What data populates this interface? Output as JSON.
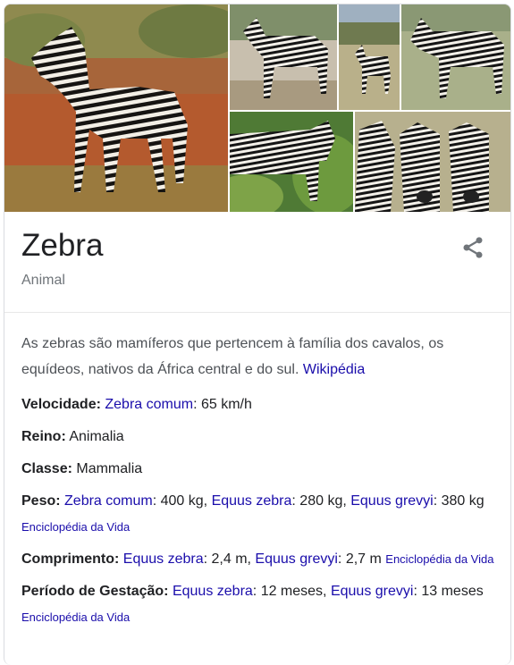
{
  "entity": {
    "title": "Zebra",
    "subtitle": "Animal"
  },
  "description": {
    "text": "As zebras são mamíferos que pertencem à família dos cavalos, os equídeos, nativos da África central e do sul.",
    "source": "Wikipédia"
  },
  "icons": {
    "share": "share-icon"
  },
  "facts": {
    "velocidade": {
      "label": "Velocidade:",
      "link1": "Zebra comum",
      "value1": ": 65 km/h"
    },
    "reino": {
      "label": "Reino:",
      "value": " Animalia"
    },
    "classe": {
      "label": "Classe:",
      "value": " Mammalia"
    },
    "peso": {
      "label": "Peso:",
      "link1": "Zebra comum",
      "value1": ": 400 kg, ",
      "link2": "Equus zebra",
      "value2": ": 280 kg, ",
      "link3": "Equus grevyi",
      "value3": ": 380 kg ",
      "source": "Enciclopédia da Vida"
    },
    "comprimento": {
      "label": "Comprimento:",
      "link1": "Equus zebra",
      "value1": ": 2,4 m, ",
      "link2": "Equus grevyi",
      "value2": ": 2,7 m ",
      "source": "Enciclopédia da Vida"
    },
    "gestacao": {
      "label": "Período de Gestação:",
      "link1": "Equus zebra",
      "value1": ": 12 meses, ",
      "link2": "Equus grevyi",
      "value2": ": 13 meses ",
      "source": "Enciclopédia da Vida"
    }
  },
  "colors": {
    "link": "#1a0dab",
    "text": "#202124",
    "muted": "#70757a",
    "border": "#dadce0"
  }
}
